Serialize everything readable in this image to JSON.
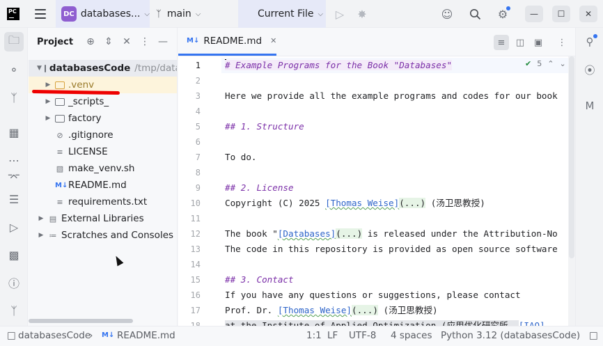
{
  "titlebar": {
    "logo": "PC",
    "project_badge": "DC",
    "project_name": "databases...",
    "branch": "main",
    "run_config": "Current File"
  },
  "project_panel": {
    "title": "Project",
    "root": {
      "name": "databasesCode",
      "path": "/tmp/data"
    },
    "items": [
      {
        "label": ".venv",
        "kind": "folder",
        "expandable": true,
        "excluded": true
      },
      {
        "label": "_scripts_",
        "kind": "folder",
        "expandable": true
      },
      {
        "label": "factory",
        "kind": "folder",
        "expandable": true
      },
      {
        "label": ".gitignore",
        "kind": "file",
        "icon": "ignore-icon"
      },
      {
        "label": "LICENSE",
        "kind": "file",
        "icon": "text-icon"
      },
      {
        "label": "make_venv.sh",
        "kind": "file",
        "icon": "shell-icon"
      },
      {
        "label": "README.md",
        "kind": "file",
        "icon": "markdown-icon"
      },
      {
        "label": "requirements.txt",
        "kind": "file",
        "icon": "text-icon"
      },
      {
        "label": "External Libraries",
        "kind": "library",
        "expandable": true
      },
      {
        "label": "Scratches and Consoles",
        "kind": "scratch",
        "expandable": true
      }
    ]
  },
  "editor": {
    "tab": {
      "label": "README.md",
      "icon_text": "M↓"
    },
    "inspection": {
      "count": "5"
    },
    "lines": [
      {
        "n": "1"
      },
      {
        "n": "2"
      },
      {
        "n": "3"
      },
      {
        "n": "4"
      },
      {
        "n": "5"
      },
      {
        "n": "6"
      },
      {
        "n": "7"
      },
      {
        "n": "8"
      },
      {
        "n": "9"
      },
      {
        "n": "10"
      },
      {
        "n": "11"
      },
      {
        "n": "12"
      },
      {
        "n": "13"
      },
      {
        "n": "14"
      },
      {
        "n": "15"
      },
      {
        "n": "16"
      },
      {
        "n": "17"
      },
      {
        "n": "18"
      }
    ],
    "text": {
      "l1": "# Example Programs for the Book \"Databases\"",
      "l3": "Here we provide all the example programs and codes for our book",
      "l5": "## 1. Structure",
      "l7": "To do.",
      "l9": "## 2. License",
      "l10_a": "Copyright (C) 2025 ",
      "l10_link": "[Thomas Weise]",
      "l10_paren": "(...)",
      "l10_b": " (汤卫思教授)",
      "l12_a": "The book \"",
      "l12_link": "[Databases]",
      "l12_paren": "(...)",
      "l12_b": " is released under the Attribution-No",
      "l13": "The code in this repository is provided as open source software",
      "l15": "## 3. Contact",
      "l16": "If you have any questions or suggestions, please contact",
      "l17_a": "Prof. Dr. ",
      "l17_link": "[Thomas Weise]",
      "l17_paren": "(...)",
      "l17_b": " (汤卫思教授)",
      "l18_a": "at the Institute of Applied Optimization (应用优化研究所, ",
      "l18_link": "[IAO]"
    }
  },
  "statusbar": {
    "breadcrumb_root": "databasesCode",
    "breadcrumb_file": "README.md",
    "breadcrumb_file_icon": "M↓",
    "position": "1:1",
    "line_sep": "LF",
    "encoding": "UTF-8",
    "indent": "4 spaces",
    "interpreter": "Python 3.12 (databasesCode)"
  },
  "colors": {
    "accent": "#3574f0",
    "badge": "#8f5ed0",
    "heading": "#7b2fa8",
    "link": "#2d64c9",
    "annotation_red": "#e00000"
  }
}
